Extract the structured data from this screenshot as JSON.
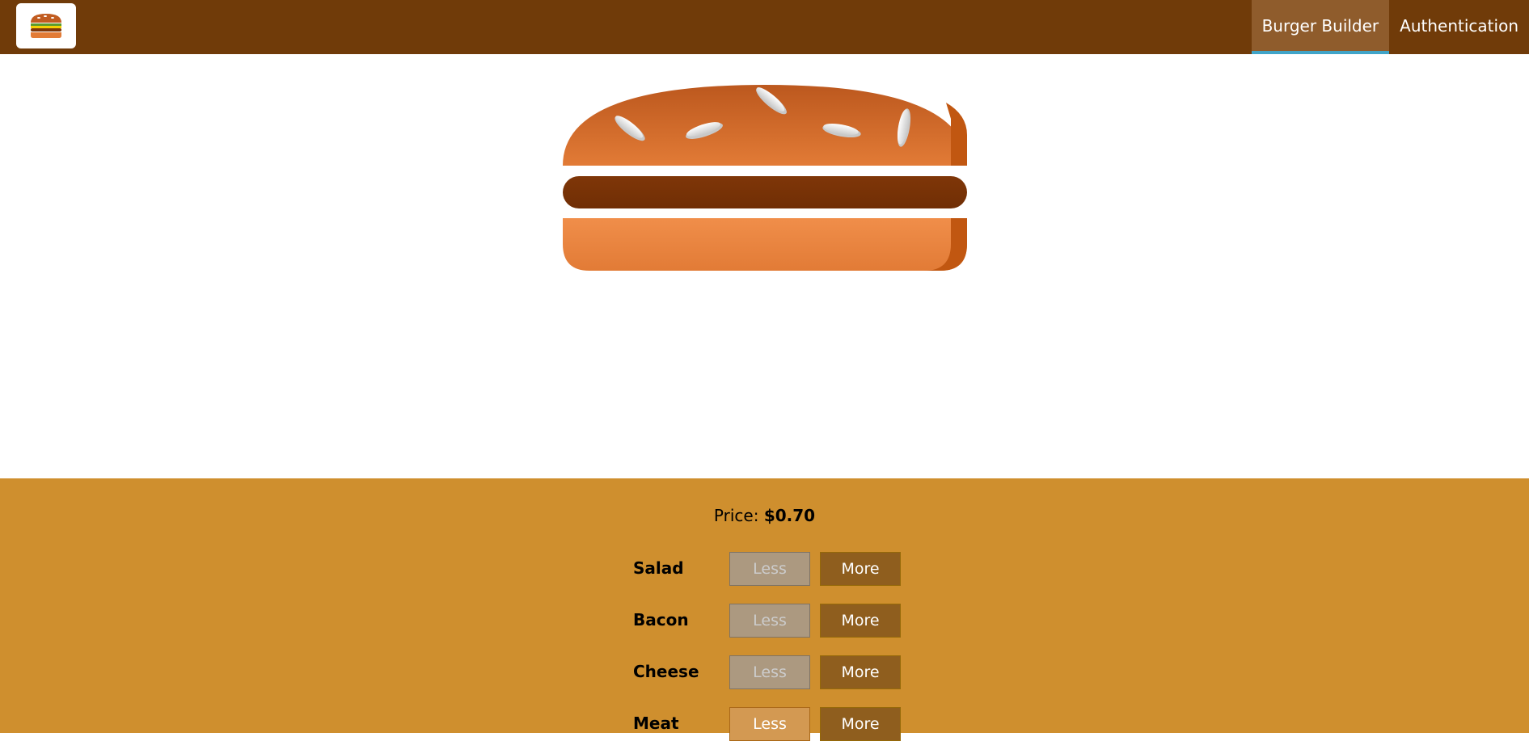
{
  "app": {
    "logo_icon": "burger-logo-icon",
    "nav": [
      {
        "label": "Burger Builder",
        "active": true
      },
      {
        "label": "Authentication",
        "active": false
      }
    ]
  },
  "colors": {
    "toolbar": "#703b09",
    "nav_active_bg": "#8f5c2c",
    "nav_active_underline": "#40a4c8",
    "controls_bg": "#cf8f2e",
    "more_button": "#8f5e1e",
    "less_button_disabled": "#ac9980",
    "less_button_enabled": "#d39952"
  },
  "burger": {
    "layers": [
      "bread-top",
      "meat",
      "bread-bottom"
    ]
  },
  "controls": {
    "price_label": "Price:",
    "price_value": "$0.70",
    "less_label": "Less",
    "more_label": "More",
    "ingredients": [
      {
        "label": "Salad",
        "less_disabled": true
      },
      {
        "label": "Bacon",
        "less_disabled": true
      },
      {
        "label": "Cheese",
        "less_disabled": true
      },
      {
        "label": "Meat",
        "less_disabled": false
      }
    ]
  }
}
